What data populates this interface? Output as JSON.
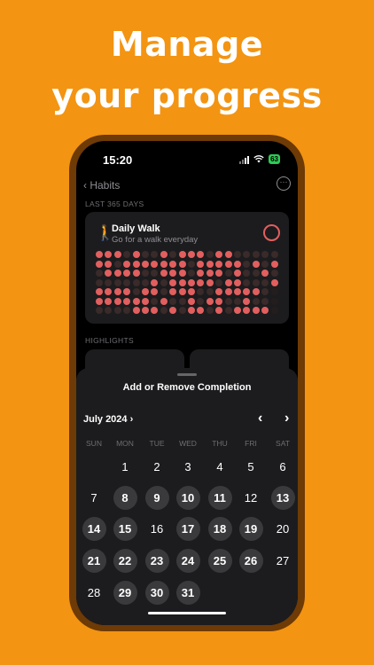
{
  "headline": {
    "line1": "Manage",
    "line2": "your progress"
  },
  "status_bar": {
    "time": "15:20",
    "battery": "63"
  },
  "nav": {
    "back_label": "Habits",
    "more_icon": "ellipsis-circle-icon"
  },
  "sections": {
    "last_365": "LAST 365 DAYS",
    "highlights": "HIGHLIGHTS"
  },
  "habit": {
    "name": "Daily Walk",
    "description": "Go for a walk everyday",
    "icon": "figure-walk-icon",
    "color": "#E25F5F"
  },
  "sheet": {
    "title": "Add or Remove Completion",
    "month": "July 2024",
    "weekdays": [
      "SUN",
      "MON",
      "TUE",
      "WED",
      "THU",
      "FRI",
      "SAT"
    ],
    "days": [
      {
        "n": "1",
        "done": false
      },
      {
        "n": "2",
        "done": false
      },
      {
        "n": "3",
        "done": false
      },
      {
        "n": "4",
        "done": false
      },
      {
        "n": "5",
        "done": false
      },
      {
        "n": "6",
        "done": false
      },
      {
        "n": "7",
        "done": false
      },
      {
        "n": "8",
        "done": true
      },
      {
        "n": "9",
        "done": true
      },
      {
        "n": "10",
        "done": true
      },
      {
        "n": "11",
        "done": true
      },
      {
        "n": "12",
        "done": false
      },
      {
        "n": "13",
        "done": true
      },
      {
        "n": "14",
        "done": true
      },
      {
        "n": "15",
        "done": true
      },
      {
        "n": "16",
        "done": false
      },
      {
        "n": "17",
        "done": true
      },
      {
        "n": "18",
        "done": true
      },
      {
        "n": "19",
        "done": true
      },
      {
        "n": "20",
        "done": false
      },
      {
        "n": "21",
        "done": true
      },
      {
        "n": "22",
        "done": true
      },
      {
        "n": "23",
        "done": true
      },
      {
        "n": "24",
        "done": true
      },
      {
        "n": "25",
        "done": true
      },
      {
        "n": "26",
        "done": true
      },
      {
        "n": "27",
        "done": false
      },
      {
        "n": "28",
        "done": false
      },
      {
        "n": "29",
        "done": true
      },
      {
        "n": "30",
        "done": true
      },
      {
        "n": "31",
        "done": true
      }
    ]
  },
  "colors": {
    "background": "#F39412",
    "accent": "#E25F5F",
    "completed_day": "#3A3A3C"
  }
}
